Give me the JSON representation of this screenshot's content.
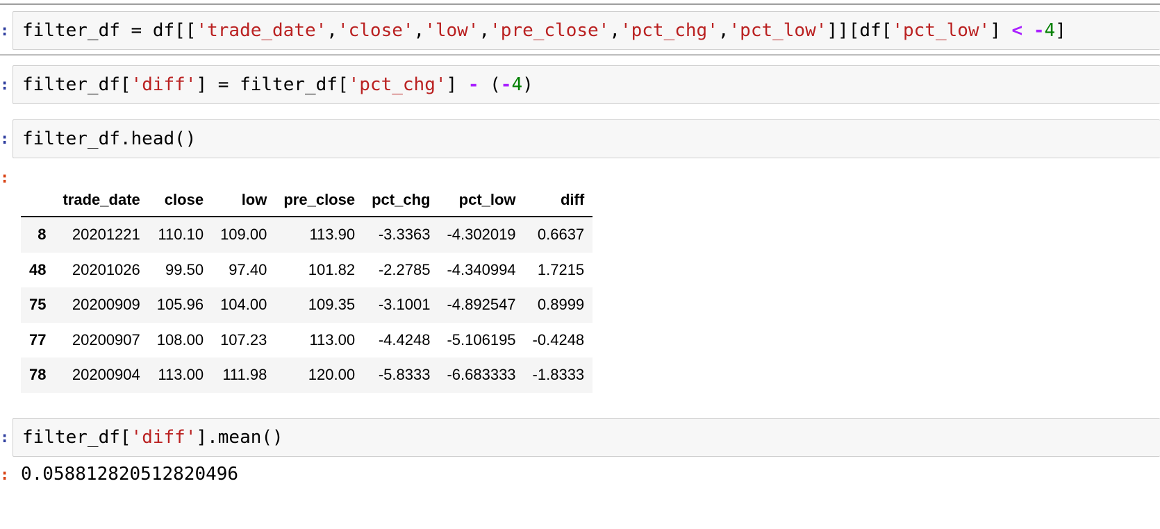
{
  "prompt_marker": ":",
  "cells": {
    "c1": {
      "tokens": [
        {
          "t": "plain",
          "v": "filter_df = df[["
        },
        {
          "t": "str",
          "v": "'trade_date'"
        },
        {
          "t": "plain",
          "v": ","
        },
        {
          "t": "str",
          "v": "'close'"
        },
        {
          "t": "plain",
          "v": ","
        },
        {
          "t": "str",
          "v": "'low'"
        },
        {
          "t": "plain",
          "v": ","
        },
        {
          "t": "str",
          "v": "'pre_close'"
        },
        {
          "t": "plain",
          "v": ","
        },
        {
          "t": "str",
          "v": "'pct_chg'"
        },
        {
          "t": "plain",
          "v": ","
        },
        {
          "t": "str",
          "v": "'pct_low'"
        },
        {
          "t": "plain",
          "v": "]][df["
        },
        {
          "t": "str",
          "v": "'pct_low'"
        },
        {
          "t": "plain",
          "v": "] "
        },
        {
          "t": "op",
          "v": "<"
        },
        {
          "t": "plain",
          "v": " "
        },
        {
          "t": "op",
          "v": "-"
        },
        {
          "t": "num",
          "v": "4"
        },
        {
          "t": "plain",
          "v": "]"
        }
      ]
    },
    "c2": {
      "tokens": [
        {
          "t": "plain",
          "v": "filter_df["
        },
        {
          "t": "str",
          "v": "'diff'"
        },
        {
          "t": "plain",
          "v": "] = filter_df["
        },
        {
          "t": "str",
          "v": "'pct_chg'"
        },
        {
          "t": "plain",
          "v": "] "
        },
        {
          "t": "op",
          "v": "-"
        },
        {
          "t": "plain",
          "v": " ("
        },
        {
          "t": "op",
          "v": "-"
        },
        {
          "t": "num",
          "v": "4"
        },
        {
          "t": "plain",
          "v": ")"
        }
      ]
    },
    "c3": {
      "tokens": [
        {
          "t": "plain",
          "v": "filter_df.head()"
        }
      ]
    },
    "c4": {
      "tokens": [
        {
          "t": "plain",
          "v": "filter_df["
        },
        {
          "t": "str",
          "v": "'diff'"
        },
        {
          "t": "plain",
          "v": "].mean()"
        }
      ]
    }
  },
  "dataframe": {
    "columns": [
      "trade_date",
      "close",
      "low",
      "pre_close",
      "pct_chg",
      "pct_low",
      "diff"
    ],
    "rows": [
      {
        "index": "8",
        "cells": [
          "20201221",
          "110.10",
          "109.00",
          "113.90",
          "-3.3363",
          "-4.302019",
          "0.6637"
        ]
      },
      {
        "index": "48",
        "cells": [
          "20201026",
          "99.50",
          "97.40",
          "101.82",
          "-2.2785",
          "-4.340994",
          "1.7215"
        ]
      },
      {
        "index": "75",
        "cells": [
          "20200909",
          "105.96",
          "104.00",
          "109.35",
          "-3.1001",
          "-4.892547",
          "0.8999"
        ]
      },
      {
        "index": "77",
        "cells": [
          "20200907",
          "108.00",
          "107.23",
          "113.00",
          "-4.4248",
          "-5.106195",
          "-0.4248"
        ]
      },
      {
        "index": "78",
        "cells": [
          "20200904",
          "113.00",
          "111.98",
          "120.00",
          "-5.8333",
          "-6.683333",
          "-1.8333"
        ]
      }
    ]
  },
  "mean_output": "0.058812820512820496"
}
